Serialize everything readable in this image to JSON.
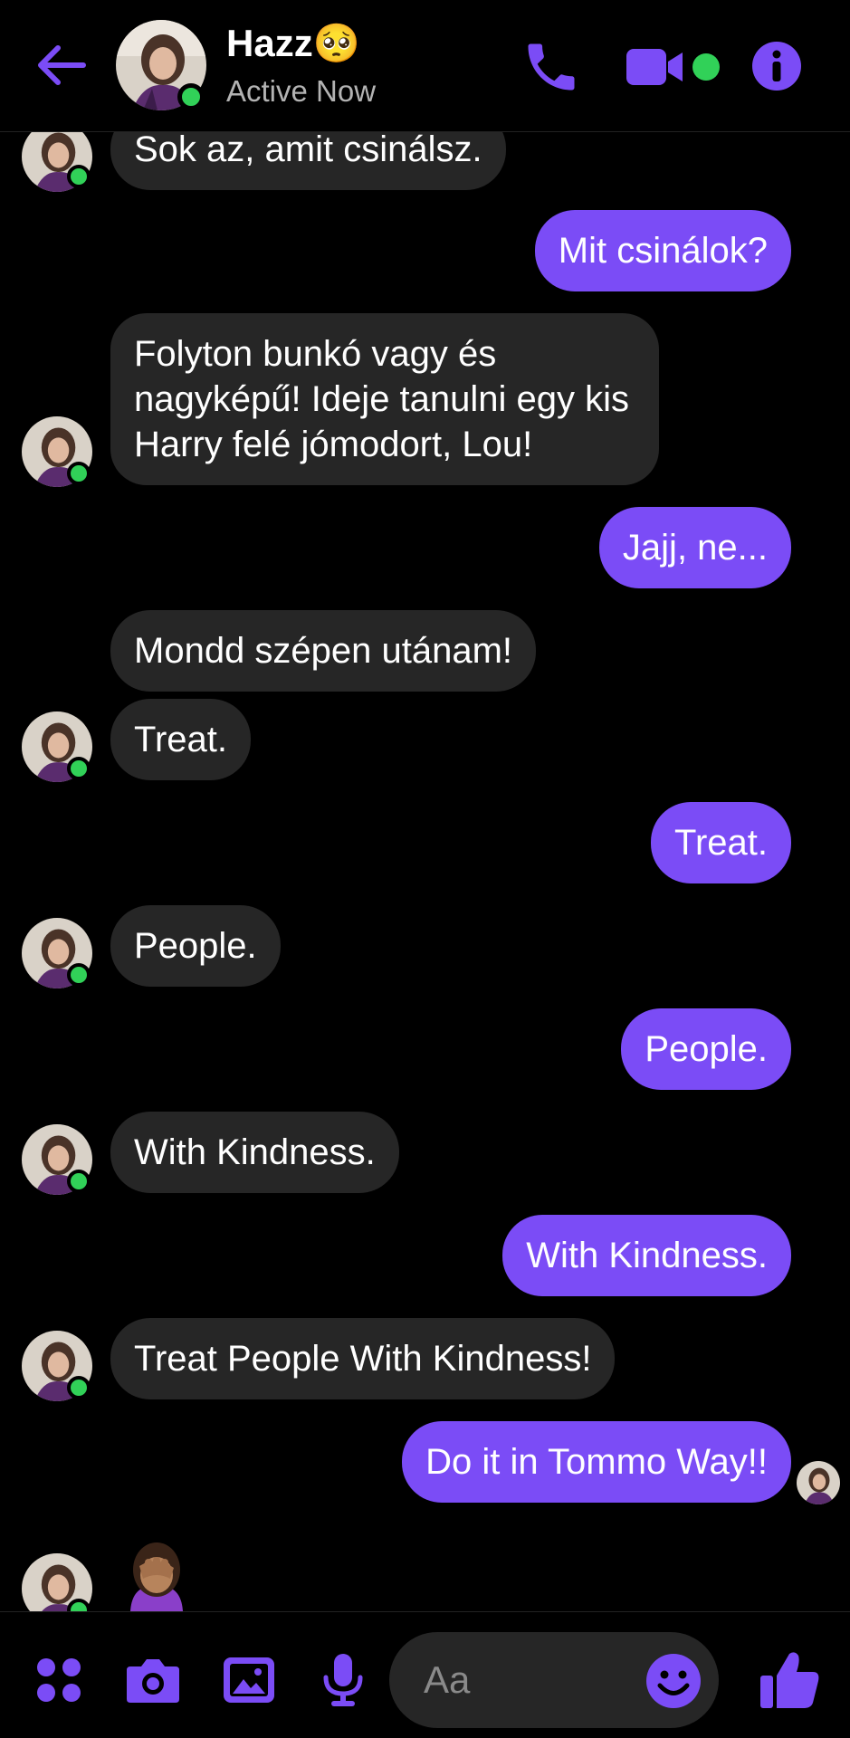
{
  "colors": {
    "accent": "#7b4cf6",
    "incoming_bubble": "#262626",
    "online": "#31d158",
    "background": "#000000"
  },
  "header": {
    "title": "Hazz🥺",
    "status": "Active Now",
    "icons": [
      "back-arrow-icon",
      "phone-icon",
      "video-camera-icon",
      "info-icon"
    ]
  },
  "messages": [
    {
      "from": "them",
      "text": "Sok az, amit csinálsz."
    },
    {
      "from": "me",
      "text": "Mit csinálok?"
    },
    {
      "from": "them",
      "text": "Folyton bunkó vagy és nagyképű! Ideje tanulni egy kis Harry felé jómodort, Lou!"
    },
    {
      "from": "me",
      "text": "Jajj, ne..."
    },
    {
      "from": "them",
      "text": "Mondd szépen utánam!"
    },
    {
      "from": "them",
      "text": "Treat."
    },
    {
      "from": "me",
      "text": "Treat."
    },
    {
      "from": "them",
      "text": "People."
    },
    {
      "from": "me",
      "text": "People."
    },
    {
      "from": "them",
      "text": "With Kindness."
    },
    {
      "from": "me",
      "text": "With Kindness."
    },
    {
      "from": "them",
      "text": "Treat People With Kindness!"
    },
    {
      "from": "me",
      "text": "Do it in Tommo Way!!"
    },
    {
      "from": "them",
      "emoji": "face-palm-emoji"
    }
  ],
  "composer": {
    "placeholder": "Aa",
    "icons": [
      "apps-icon",
      "camera-icon",
      "gallery-icon",
      "microphone-icon",
      "emoji-icon",
      "thumbs-up-icon"
    ]
  }
}
